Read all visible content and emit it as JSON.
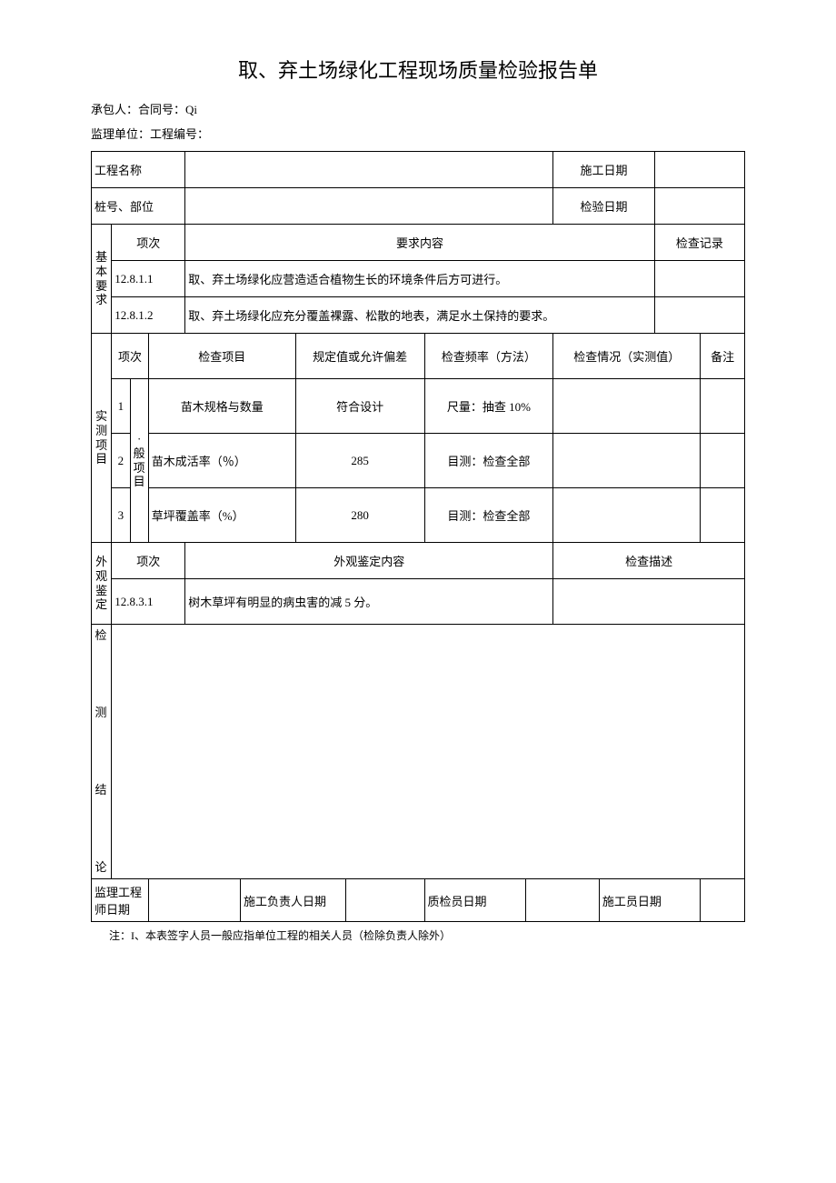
{
  "title": "取、弃土场绿化工程现场质量检验报告单",
  "meta": {
    "contractor_line": "承包人：合同号：Qi",
    "supervisor_line": "监理单位：工程编号："
  },
  "header_rows": {
    "project_name_label": "工程名称",
    "construction_date_label": "施工日期",
    "pile_label": "桩号、部位",
    "inspection_date_label": "检验日期"
  },
  "basic": {
    "section_label": "基本要求",
    "item_header": "项次",
    "content_header": "要求内容",
    "record_header": "检查记录",
    "rows": [
      {
        "no": "12.8.1.1",
        "content": "取、弃土场绿化应营造适合植物生长的环境条件后方可进行。"
      },
      {
        "no": "12.8.1.2",
        "content": "取、弃土场绿化应充分覆盖裸露、松散的地表，满足水土保持的要求。"
      }
    ]
  },
  "measured": {
    "section_label": "实测项目",
    "item_no_header": "项次",
    "check_item_header": "检查项目",
    "spec_header": "规定值或允许偏差",
    "freq_header": "检查频率（方法）",
    "situation_header": "检查情况（实测值）",
    "remark_header": "备注",
    "group_label": "·般项目",
    "rows": [
      {
        "idx": "1",
        "item": "苗木规格与数量",
        "spec": "符合设计",
        "freq": "尺量：抽查 10%"
      },
      {
        "idx": "2",
        "item": "苗木成活率（％）",
        "spec": "285",
        "freq": "目测：检查全部"
      },
      {
        "idx": "3",
        "item": "草坪覆盖率（%）",
        "spec": "280",
        "freq": "目测：检查全部"
      }
    ]
  },
  "appearance": {
    "section_label": "外观鉴定",
    "item_header": "项次",
    "content_header": "外观鉴定内容",
    "desc_header": "检查描述",
    "rows": [
      {
        "no": "12.8.3.1",
        "content": "树木草坪有明显的病虫害的减 5 分。"
      }
    ]
  },
  "conclusion": {
    "label_chars": [
      "检",
      "测",
      "结",
      "论"
    ]
  },
  "signatures": {
    "supervisor_date": "监理工程师日期",
    "construction_lead_date": "施工负责人日期",
    "qc_date": "质检员日期",
    "worker_date": "施工员日期"
  },
  "footnote": "注：I、本表签字人员一般应指单位工程的相关人员（检除负责人除外）"
}
